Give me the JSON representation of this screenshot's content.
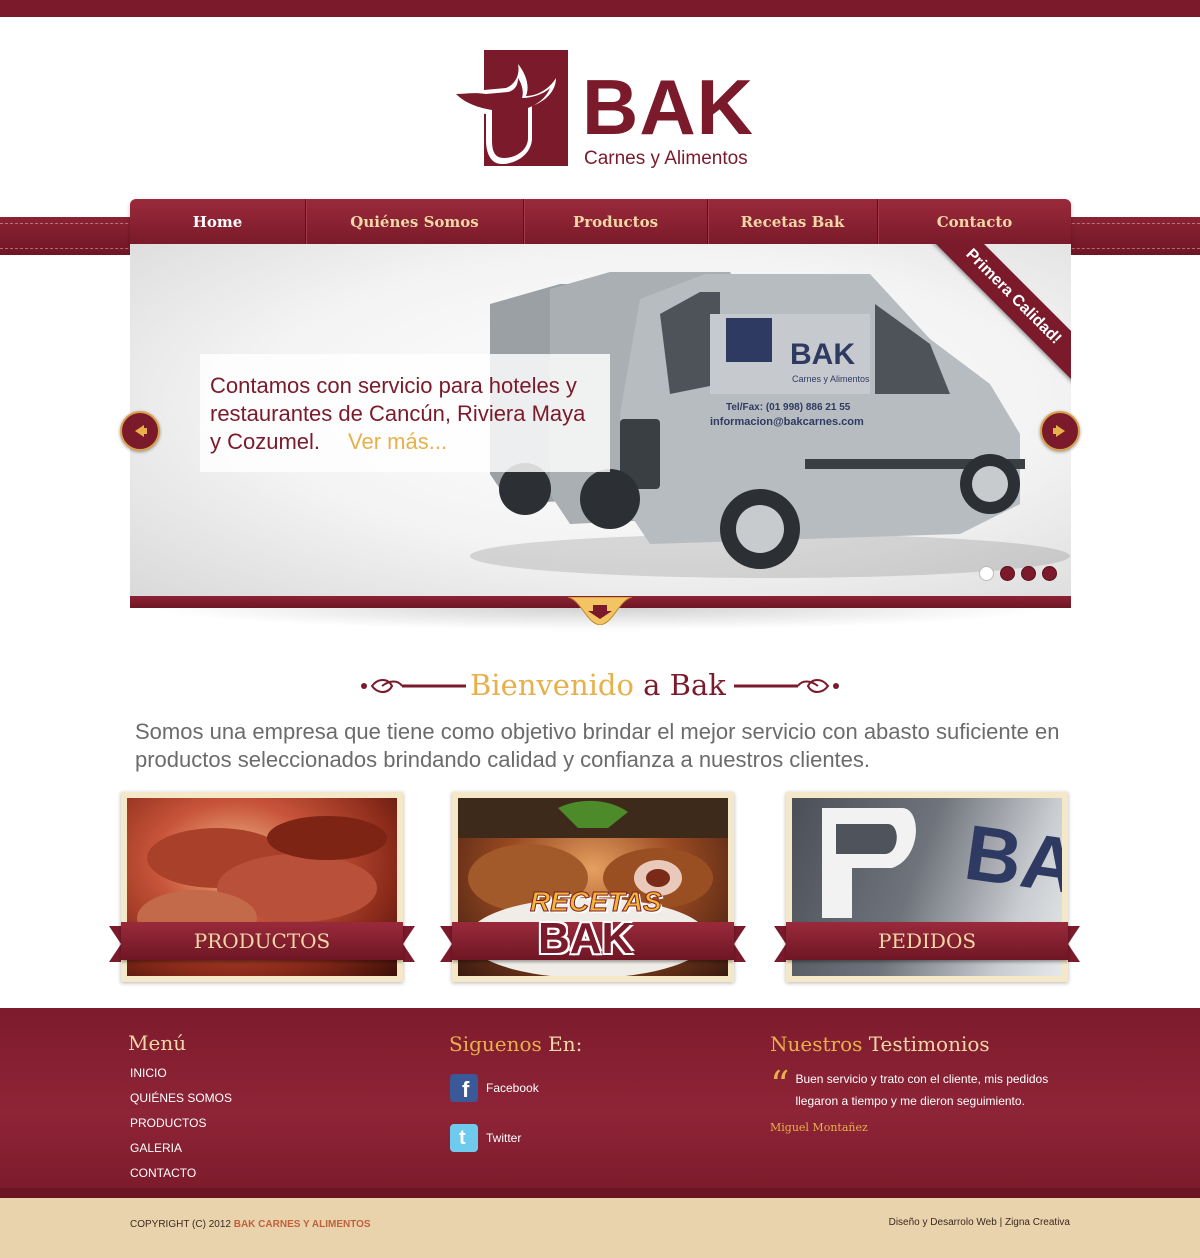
{
  "brand": {
    "name": "BAK",
    "tagline": "Carnes y Alimentos",
    "color": "#7b1a2a",
    "accent": "#e7b04b"
  },
  "nav": {
    "items": [
      {
        "label": "Home",
        "active": true
      },
      {
        "label": "Quiénes Somos"
      },
      {
        "label": "Productos"
      },
      {
        "label": "Recetas Bak"
      },
      {
        "label": "Contacto"
      }
    ]
  },
  "slider": {
    "caption_text": "Contamos con servicio para hoteles y restaurantes de Cancún, Riviera Maya y Cozumel.",
    "caption_link": "Ver más...",
    "ribbon": "Primera Calidad!",
    "van_logo": "BAK",
    "van_sub": "Carnes y Alimentos",
    "van_phone": "Tel/Fax: (01 998) 886 21 55",
    "van_email": "informacion@bakcarnes.com",
    "dots_total": 4,
    "active_dot": 1
  },
  "welcome": {
    "title_highlight": "Bienvenido",
    "title_rest": " a Bak",
    "text": "Somos una empresa que tiene como objetivo brindar el mejor servicio con abasto suficiente en productos seleccionados brindando calidad y confianza a nuestros clientes."
  },
  "features": [
    {
      "label": "PRODUCTOS"
    },
    {
      "logo_top": "RECETAS",
      "logo_bottom": "BAK"
    },
    {
      "label": "PEDIDOS"
    }
  ],
  "footer": {
    "menu_title": "Menú",
    "menu_links": [
      "INICIO",
      "QUIÉNES SOMOS",
      "PRODUCTOS",
      "GALERIA",
      "CONTACTO"
    ],
    "social_title_highlight": "Siguenos",
    "social_title_rest": " En:",
    "social": [
      {
        "label": "Facebook",
        "icon": "facebook-icon"
      },
      {
        "label": "Twitter",
        "icon": "twitter-icon"
      }
    ],
    "testimonial_title_highlight": "Nuestros",
    "testimonial_title_rest": " Testimonios",
    "testimonial_quote": "“",
    "testimonial_text": "Buen servicio y trato con el cliente, mis pedidos llegaron a tiempo y me dieron seguimiento.",
    "testimonial_author": "Miguel Montañez"
  },
  "copyright": {
    "prefix": "COPYRIGHT (C) 2012 ",
    "brand": "BAK CARNES Y ALIMENTOS",
    "credits": "Diseño y Desarrolo Web | Zigna Creativa"
  }
}
